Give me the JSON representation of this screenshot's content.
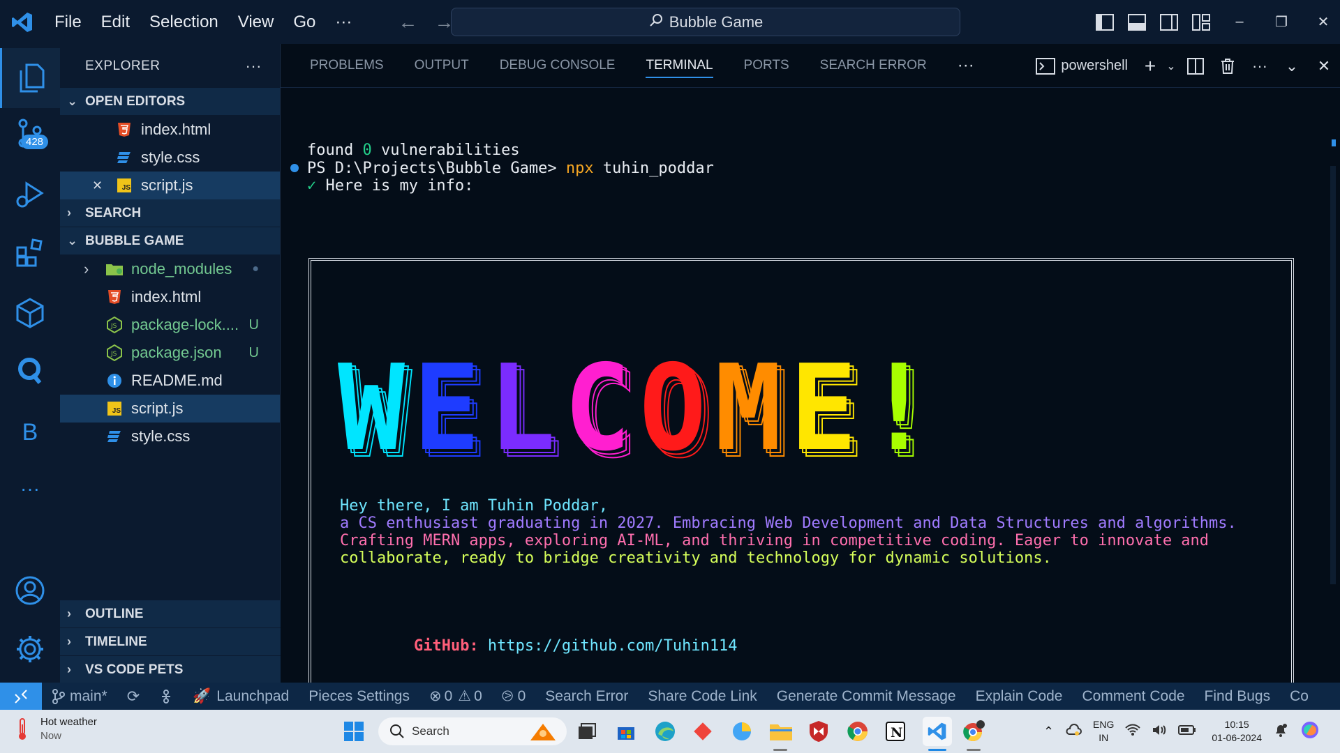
{
  "titlebar": {
    "menu": [
      "File",
      "Edit",
      "Selection",
      "View",
      "Go",
      "···"
    ],
    "search_text": "Bubble Game",
    "window_controls": [
      "–",
      "❐",
      "✕"
    ]
  },
  "activitybar": {
    "badge": "428",
    "letter_b": "B",
    "more": "···"
  },
  "sidebar": {
    "title": "EXPLORER",
    "more": "···",
    "open_editors_label": "OPEN EDITORS",
    "open_editors": [
      {
        "name": "index.html",
        "icon": "html5-icon"
      },
      {
        "name": "style.css",
        "icon": "css-icon"
      },
      {
        "name": "script.js",
        "icon": "js-icon",
        "close": "✕"
      }
    ],
    "search_label": "SEARCH",
    "project_label": "BUBBLE GAME",
    "files": [
      {
        "name": "node_modules",
        "icon": "folder-icon",
        "status": "●"
      },
      {
        "name": "index.html",
        "icon": "html5-icon",
        "status": ""
      },
      {
        "name": "package-lock....",
        "icon": "nodejs-icon",
        "status": "U"
      },
      {
        "name": "package.json",
        "icon": "nodejs-icon",
        "status": "U"
      },
      {
        "name": "README.md",
        "icon": "info-icon",
        "status": ""
      },
      {
        "name": "script.js",
        "icon": "js-icon",
        "status": ""
      },
      {
        "name": "style.css",
        "icon": "css-icon",
        "status": ""
      }
    ],
    "outline_label": "OUTLINE",
    "timeline_label": "TIMELINE",
    "pets_label": "VS CODE PETS"
  },
  "panel": {
    "tabs": [
      "PROBLEMS",
      "OUTPUT",
      "DEBUG CONSOLE",
      "TERMINAL",
      "PORTS",
      "SEARCH ERROR"
    ],
    "active_tab": "TERMINAL",
    "more": "···",
    "shell": "powershell"
  },
  "terminal": {
    "found_prefix": "found ",
    "found_count": "0",
    "found_suffix": " vulnerabilities",
    "prompt": "PS D:\\Projects\\Bubble Game> ",
    "cmd_name": "npx",
    "cmd_arg": " tuhin_poddar",
    "check": "✓",
    "info_heading": " Here is my info:",
    "welcome": "WELCOME!",
    "welcome_colors": [
      "#00e5ff",
      "#1e3cff",
      "#7b2cff",
      "#ff1fd0",
      "#ff1a1a",
      "#ff8c00",
      "#ffe600",
      "#a8ff00",
      "#00e03a"
    ],
    "bio": [
      {
        "text": "Hey there, I am Tuhin Poddar,",
        "color": "#6fe6ff"
      },
      {
        "text": "a CS enthusiast graduating in 2027. Embracing Web Development and Data Structures and algorithms.",
        "color": "#a07bff"
      },
      {
        "text": "Crafting MERN apps, exploring AI-ML, and thriving in competitive coding. Eager to innovate and",
        "color": "#ff6fae"
      },
      {
        "text": "collaborate, ready to bridge creativity and technology for dynamic solutions.",
        "color": "#d6ff5a"
      }
    ],
    "github_label": "GitHub:",
    "github_url": " https://github.com/Tuhin114"
  },
  "statusbar": {
    "branch": "main*",
    "launchpad": "Launchpad",
    "pieces": "Pieces Settings",
    "errors": "0",
    "warnings": "0",
    "ports": "0",
    "items": [
      "Search Error",
      "Share Code Link",
      "Generate Commit Message",
      "Explain Code",
      "Comment Code",
      "Find Bugs",
      "Co"
    ]
  },
  "taskbar": {
    "weather_title": "Hot weather",
    "weather_sub": "Now",
    "search_placeholder": "Search",
    "lang_top": "ENG",
    "lang_bottom": "IN",
    "time": "10:15",
    "date": "01-06-2024"
  }
}
